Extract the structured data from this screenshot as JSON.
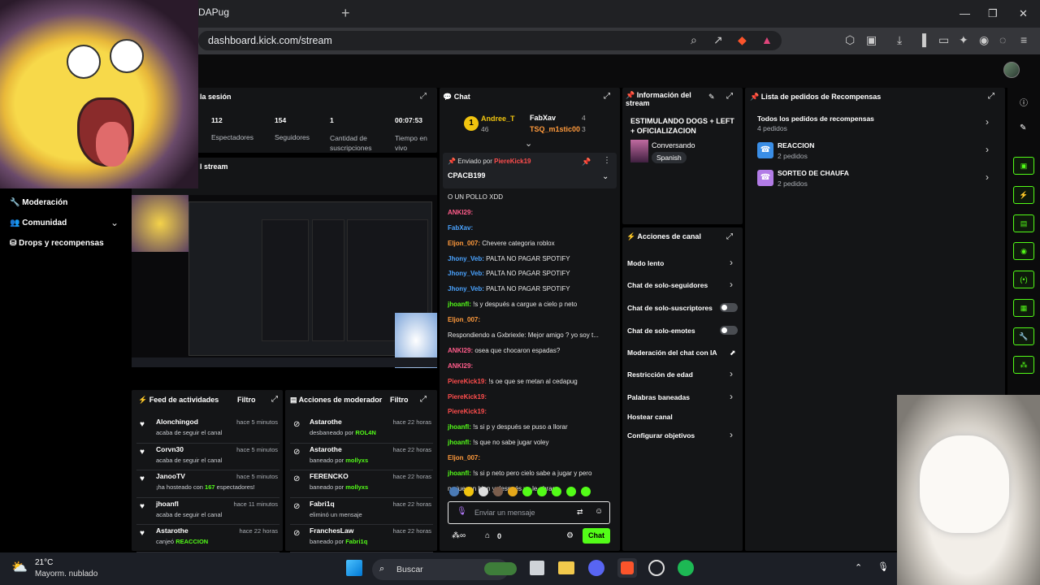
{
  "browser": {
    "tab_title": "EDAPug",
    "url": "dashboard.kick.com/stream"
  },
  "nav": {
    "moderation": "Moderación",
    "community": "Comunidad",
    "drops": "Drops y recompensas"
  },
  "session": {
    "title_fragment": "la sesión",
    "viewers_value": "112",
    "viewers_label": "Espectadores",
    "followers_value": "154",
    "followers_label": "Seguidores",
    "subs_value": "1",
    "subs_label": "Cantidad de suscripciones",
    "time_value": "00:07:53",
    "time_label": "Tiempo en vivo"
  },
  "stream_title_fragment": "l stream",
  "chat": {
    "title": "Chat",
    "leaders": [
      {
        "rank": "1",
        "name": "Andree_T",
        "value": "46"
      },
      {
        "name": "FabXav",
        "value": "4"
      },
      {
        "name": "TSQ_m1stic00",
        "value": "3"
      }
    ],
    "pinned_by": "Enviado por",
    "pinned_user": "PiereKick19",
    "pinned_msg": "CPACB199",
    "lines": [
      {
        "user": "",
        "cls": "",
        "text": "O UN POLLO XDD"
      },
      {
        "user": "ANKI29:",
        "cls": "u-pink",
        "text": ""
      },
      {
        "user": "FabXav:",
        "cls": "u-blue",
        "text": ""
      },
      {
        "user": "Eljon_007:",
        "cls": "u-orange",
        "text": " Chevere categoria roblox"
      },
      {
        "user": "Jhony_Veb:",
        "cls": "u-blue",
        "text": " PALTA NO PAGAR SPOTIFY"
      },
      {
        "user": "Jhony_Veb:",
        "cls": "u-blue",
        "text": " PALTA NO PAGAR SPOTIFY"
      },
      {
        "user": "Jhony_Veb:",
        "cls": "u-blue",
        "text": " PALTA NO PAGAR SPOTIFY"
      },
      {
        "user": "jhoanfl:",
        "cls": "u-green",
        "text": " !s y después a cargue a cielo p neto"
      },
      {
        "user": "Eljon_007:",
        "cls": "u-orange",
        "text": ""
      },
      {
        "user": "",
        "cls": "",
        "text": "Respondiendo a Gxbriexle: Mejor amigo ? yo soy t..."
      },
      {
        "user": "ANKI29:",
        "cls": "u-pink",
        "text": " osea que chocaron espadas?"
      },
      {
        "user": "ANKI29:",
        "cls": "u-pink",
        "text": ""
      },
      {
        "user": "PiereKick19:",
        "cls": "u-red",
        "text": " !s oe que se metan al cedapug"
      },
      {
        "user": "PiereKick19:",
        "cls": "u-red",
        "text": ""
      },
      {
        "user": "PiereKick19:",
        "cls": "u-red",
        "text": ""
      },
      {
        "user": "jhoanfl:",
        "cls": "u-green",
        "text": " !s si p y después se puso a llorar"
      },
      {
        "user": "jhoanfl:",
        "cls": "u-green",
        "text": " !s que no sabe jugar voley"
      },
      {
        "user": "Eljon_007:",
        "cls": "u-orange",
        "text": ""
      },
      {
        "user": "jhoanfl:",
        "cls": "u-green",
        "text": " !s si p neto pero cielo sabe a jugar y pero"
      },
      {
        "user": "",
        "cls": "",
        "text": "no juegan bien y después yo le abrace"
      }
    ],
    "input_placeholder": "Enviar un mensaje",
    "points": "0",
    "send": "Chat"
  },
  "info": {
    "title": "Información del stream",
    "stream_title": "ESTIMULANDO DOGS + LEFT + OFICIALIZACION",
    "category": "Conversando",
    "language": "Spanish"
  },
  "channel_actions": {
    "title": "Acciones de canal",
    "items": [
      "Modo lento",
      "Chat de solo-seguidores",
      "Chat de solo-suscriptores",
      "Chat de solo-emotes",
      "Moderación del chat con IA",
      "Restricción de edad",
      "Palabras baneadas",
      "Hostear canal",
      "Configurar objetivos"
    ]
  },
  "rewards": {
    "title": "Lista de pedidos de Recompensas",
    "all_title": "Todos los pedidos de recompensas",
    "all_count": "4 pedidos",
    "items": [
      {
        "name": "REACCION",
        "count": "2 pedidos"
      },
      {
        "name": "SORTEO DE CHAUFA",
        "count": "2 pedidos"
      }
    ]
  },
  "feed": {
    "title": "Feed de actividades",
    "filter": "Filtro",
    "items": [
      {
        "user": "Alonchingod",
        "time": "hace 5 minutos",
        "desc": "acaba de seguir el canal",
        "extra": "",
        "after": ""
      },
      {
        "user": "Corvn30",
        "time": "hace 5 minutos",
        "desc": "acaba de seguir el canal",
        "extra": "",
        "after": ""
      },
      {
        "user": "JanooTV",
        "time": "hace 5 minutos",
        "desc": "¡ha hosteado con ",
        "extra": "167",
        "after": " espectadores!"
      },
      {
        "user": "jhoanfl",
        "time": "hace 11 minutos",
        "desc": "acaba de seguir el canal",
        "extra": "",
        "after": ""
      },
      {
        "user": "Astarothe",
        "time": "hace 22 horas",
        "desc": "canjeó ",
        "extra": "REACCION",
        "after": ""
      }
    ]
  },
  "modactions": {
    "title": "Acciones de moderador",
    "filter": "Filtro",
    "items": [
      {
        "user": "Astarothe",
        "time": "hace 22 horas",
        "desc": "desbaneado por ",
        "by": "ROL4N"
      },
      {
        "user": "Astarothe",
        "time": "hace 22 horas",
        "desc": "baneado por ",
        "by": "mollyxs"
      },
      {
        "user": "FERENCKO",
        "time": "hace 22 horas",
        "desc": "baneado por ",
        "by": "mollyxs"
      },
      {
        "user": "Fabri1q",
        "time": "hace 22 horas",
        "desc": "eliminó un mensaje",
        "by": ""
      },
      {
        "user": "FranchesLaw",
        "time": "hace 22 horas",
        "desc": "baneado por ",
        "by": "Fabri1q"
      }
    ]
  },
  "taskbar": {
    "temp": "21°C",
    "weather": "Mayorm. nublado",
    "search": "Buscar"
  }
}
